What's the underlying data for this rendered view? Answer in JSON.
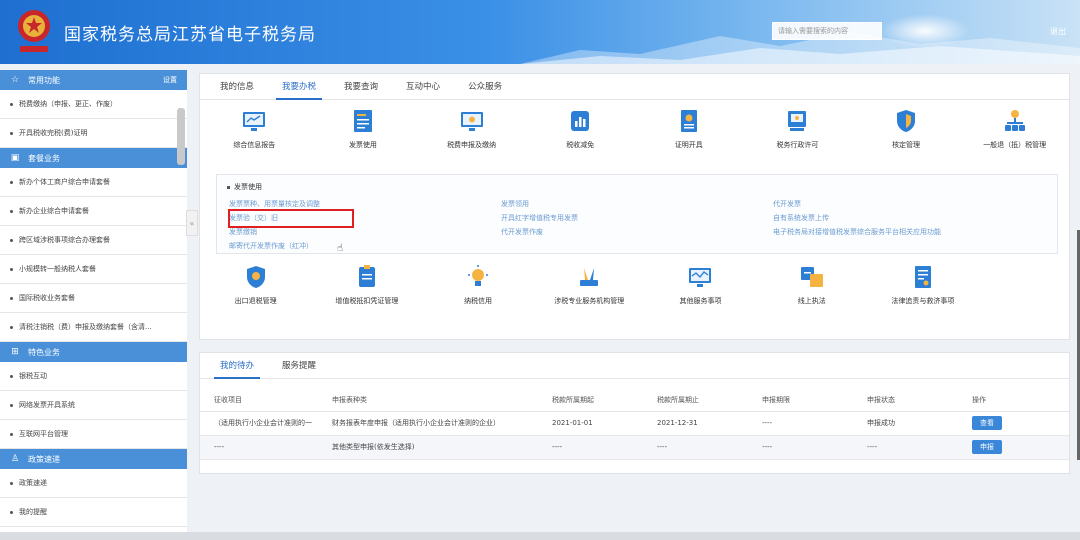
{
  "header": {
    "title": "国家税务总局江苏省电子税务局",
    "search_placeholder": "请输入需要搜索的内容",
    "logout": "退出"
  },
  "colors": {
    "header_blue": "#1e6fd0",
    "section_blue": "#4a90d9",
    "tab_active": "#2a6fc9",
    "highlight_red": "#e02020"
  },
  "sidebar": {
    "sections": [
      {
        "title": "常用功能",
        "icon": "star-icon",
        "setting": "设置",
        "items": [
          "税费缴纳（申报、更正、作废）",
          "开具税收完税(费)证明"
        ]
      },
      {
        "title": "套餐业务",
        "icon": "package-icon",
        "items": [
          "新办个体工商户综合申请套餐",
          "新办企业综合申请套餐",
          "跨区域涉税事项综合办理套餐",
          "小规模转一般纳税人套餐",
          "国际税收业务套餐",
          "清税注销税（费）申报及缴纳套餐（含清..."
        ]
      },
      {
        "title": "特色业务",
        "icon": "grid-icon",
        "items": [
          "银税互动",
          "网络发票开具系统",
          "互联网平台管理"
        ]
      },
      {
        "title": "政策速递",
        "icon": "user-icon",
        "items": [
          "政策速递",
          "我的提醒"
        ]
      }
    ]
  },
  "main": {
    "tabs": [
      "我的信息",
      "我要办税",
      "我要查询",
      "互动中心",
      "公众服务"
    ],
    "active_tab": "我要办税",
    "row1": [
      "综合信息报告",
      "发票使用",
      "税费申报及缴纳",
      "税收减免",
      "证明开具",
      "税务行政许可",
      "核定管理",
      "一般退（抵）税管理"
    ],
    "submenu": {
      "title": "发票使用",
      "col1": [
        "发票票种、用票量核定及调整",
        "发票验（交）旧",
        "发票缴销",
        "邮寄代开发票作废（红冲）"
      ],
      "col2": [
        "发票领用",
        "开具红字增值税专用发票",
        "代开发票作废"
      ],
      "col3": [
        "代开发票",
        "自有系统发票上传",
        "电子税务局对接增值税发票综合服务平台相关应用功能"
      ]
    },
    "row2": [
      "出口退税管理",
      "增值税抵扣凭证管理",
      "纳税信用",
      "涉税专业服务机构管理",
      "其他服务事项",
      "线上执法",
      "法律追责与救济事项"
    ]
  },
  "todo": {
    "tabs": [
      "我的待办",
      "服务提醒"
    ],
    "columns": [
      "征收项目",
      "申报表种类",
      "税款所属期起",
      "税款所属期止",
      "申报期限",
      "申报状态",
      "操作"
    ],
    "rows": [
      [
        "（适用执行小企业会计准则的一",
        "财务报表年度申报（适用执行小企业会计准则的企业）",
        "2021-01-01",
        "2021-12-31",
        "----",
        "申报成功",
        "查看"
      ],
      [
        "----",
        "其他类型申报(依发生选择)",
        "----",
        "----",
        "----",
        "----",
        "申报"
      ]
    ]
  }
}
